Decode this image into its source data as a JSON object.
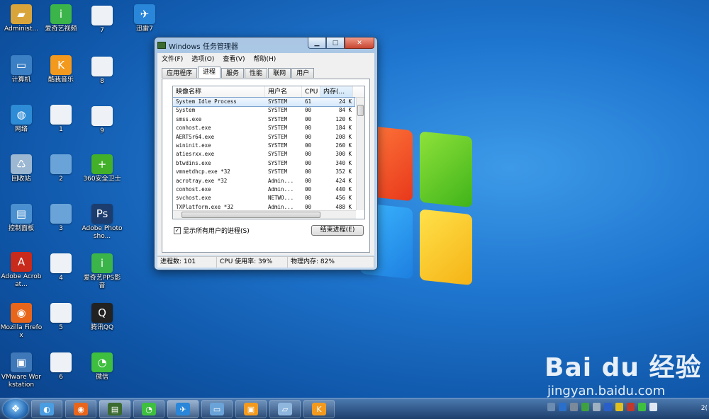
{
  "desktop_icons": [
    {
      "label": "Administ...",
      "icon": "user-folder-icon",
      "color": "#d9a53a",
      "glyph": "▰"
    },
    {
      "label": "计算机",
      "icon": "computer-icon",
      "color": "#3b7fc4",
      "glyph": "▭"
    },
    {
      "label": "网络",
      "icon": "network-globe-icon",
      "color": "#2e8bd6",
      "glyph": "◍"
    },
    {
      "label": "回收站",
      "icon": "recycle-bin-icon",
      "color": "#9bb7d2",
      "glyph": "♺"
    },
    {
      "label": "控制面板",
      "icon": "control-panel-icon",
      "color": "#4a90d0",
      "glyph": "▤"
    },
    {
      "label": "Adobe Acrobat...",
      "icon": "acrobat-pdf-icon",
      "color": "#c82a1c",
      "glyph": "A"
    },
    {
      "label": "Mozilla Firefox",
      "icon": "firefox-icon",
      "color": "#e8661c",
      "glyph": "◉"
    },
    {
      "label": "VMware Workstation",
      "icon": "vmware-icon",
      "color": "#3f78b8",
      "glyph": "▣"
    },
    {
      "label": "爱奇艺视频",
      "icon": "iqiyi-icon",
      "color": "#3bb54a",
      "glyph": "i"
    },
    {
      "label": "酷我音乐",
      "icon": "kuwo-music-icon",
      "color": "#f39a1e",
      "glyph": "K"
    },
    {
      "label": "1",
      "icon": "document-thumb-icon",
      "color": "#eef2f6",
      "glyph": ""
    },
    {
      "label": "2",
      "icon": "screenshot-thumb-icon",
      "color": "#6aa3d8",
      "glyph": ""
    },
    {
      "label": "3",
      "icon": "screenshot-thumb-icon",
      "color": "#6aa3d8",
      "glyph": ""
    },
    {
      "label": "4",
      "icon": "document-thumb-icon",
      "color": "#eef2f6",
      "glyph": ""
    },
    {
      "label": "5",
      "icon": "document-thumb-icon",
      "color": "#eef2f6",
      "glyph": ""
    },
    {
      "label": "6",
      "icon": "document-thumb-icon",
      "color": "#eef2f6",
      "glyph": ""
    },
    {
      "label": "7",
      "icon": "document-thumb-icon",
      "color": "#eef2f6",
      "glyph": ""
    },
    {
      "label": "8",
      "icon": "document-thumb-icon",
      "color": "#eef2f6",
      "glyph": ""
    },
    {
      "label": "9",
      "icon": "document-thumb-icon",
      "color": "#eef2f6",
      "glyph": ""
    },
    {
      "label": "360安全卫士",
      "icon": "360-safeguard-icon",
      "color": "#43b02a",
      "glyph": "+"
    },
    {
      "label": "Adobe Photosho...",
      "icon": "photoshop-icon",
      "color": "#1c3d6e",
      "glyph": "Ps"
    },
    {
      "label": "爱奇艺PPS影音",
      "icon": "pps-player-icon",
      "color": "#3bb54a",
      "glyph": "i"
    },
    {
      "label": "腾讯QQ",
      "icon": "qq-penguin-icon",
      "color": "#222222",
      "glyph": "Q"
    },
    {
      "label": "微信",
      "icon": "wechat-icon",
      "color": "#3fbf3f",
      "glyph": "◔"
    },
    {
      "label": "迅雷7",
      "icon": "xunlei-icon",
      "color": "#2a86d8",
      "glyph": "✈"
    }
  ],
  "task_manager": {
    "title": "Windows 任务管理器",
    "window_buttons": {
      "minimize": "▁",
      "maximize": "□",
      "close": "✕"
    },
    "menu": [
      "文件(F)",
      "选项(O)",
      "查看(V)",
      "帮助(H)"
    ],
    "tabs": [
      "应用程序",
      "进程",
      "服务",
      "性能",
      "联网",
      "用户"
    ],
    "active_tab": "进程",
    "columns": [
      "映像名称",
      "用户名",
      "CPU",
      "内存(..."
    ],
    "rows": [
      [
        "System Idle Process",
        "SYSTEM",
        "61",
        "24 K"
      ],
      [
        "System",
        "SYSTEM",
        "00",
        "84 K"
      ],
      [
        "smss.exe",
        "SYSTEM",
        "00",
        "120 K"
      ],
      [
        "conhost.exe",
        "SYSTEM",
        "00",
        "184 K"
      ],
      [
        "AERTSr64.exe",
        "SYSTEM",
        "00",
        "208 K"
      ],
      [
        "wininit.exe",
        "SYSTEM",
        "00",
        "260 K"
      ],
      [
        "atiesrxx.exe",
        "SYSTEM",
        "00",
        "300 K"
      ],
      [
        "btwdins.exe",
        "SYSTEM",
        "00",
        "340 K"
      ],
      [
        "vmnetdhcp.exe *32",
        "SYSTEM",
        "00",
        "352 K"
      ],
      [
        "acrotray.exe *32",
        "Admin...",
        "00",
        "424 K"
      ],
      [
        "conhost.exe",
        "Admin...",
        "00",
        "440 K"
      ],
      [
        "svchost.exe",
        "NETWO...",
        "00",
        "456 K"
      ],
      [
        "TXPlatform.exe *32",
        "Admin...",
        "00",
        "488 K"
      ]
    ],
    "show_all_label": "显示所有用户的进程(S)",
    "show_all_checked": "✓",
    "end_process_label": "结束进程(E)",
    "status": {
      "processes": "进程数: 101",
      "cpu": "CPU 使用率: 39%",
      "memory": "物理内存: 82%"
    }
  },
  "watermark": {
    "main": "Bai du 经验",
    "sub": "jingyan.baidu.com"
  },
  "taskbar": {
    "start_glyph": "❖",
    "buttons": [
      {
        "icon": "360-browser-icon",
        "color": "#4a9de0",
        "glyph": "◐"
      },
      {
        "icon": "firefox-icon",
        "color": "#e8661c",
        "glyph": "◉"
      },
      {
        "icon": "task-manager-icon",
        "color": "#3b6b2f",
        "glyph": "▤"
      },
      {
        "icon": "wechat-icon",
        "color": "#3fbf3f",
        "glyph": "◔"
      },
      {
        "icon": "xunlei-icon",
        "color": "#2a86d8",
        "glyph": "✈"
      },
      {
        "icon": "display-settings-icon",
        "color": "#6aa3d8",
        "glyph": "▭"
      },
      {
        "icon": "vmware-icon",
        "color": "#f39a1e",
        "glyph": "▣"
      },
      {
        "icon": "notepad-icon",
        "color": "#8fb7de",
        "glyph": "▱"
      },
      {
        "icon": "kuwo-music-icon",
        "color": "#f39a1e",
        "glyph": "K"
      }
    ],
    "tray_icons": [
      {
        "icon": "keyboard-icon",
        "color": "#6b8bb0"
      },
      {
        "icon": "help-icon",
        "color": "#2a6fc9"
      },
      {
        "icon": "tools-icon",
        "color": "#7a8a9a"
      },
      {
        "icon": "battery-icon",
        "color": "#3fa03f"
      },
      {
        "icon": "network-icon",
        "color": "#9fb0c0"
      },
      {
        "icon": "bluetooth-icon",
        "color": "#2a5fc9"
      },
      {
        "icon": "360-tray-icon",
        "color": "#e0c020"
      },
      {
        "icon": "security-icon",
        "color": "#c0392b"
      },
      {
        "icon": "sync-icon",
        "color": "#3fbf3f"
      },
      {
        "icon": "volume-icon",
        "color": "#dfe8f2"
      }
    ],
    "clock": "2("
  }
}
